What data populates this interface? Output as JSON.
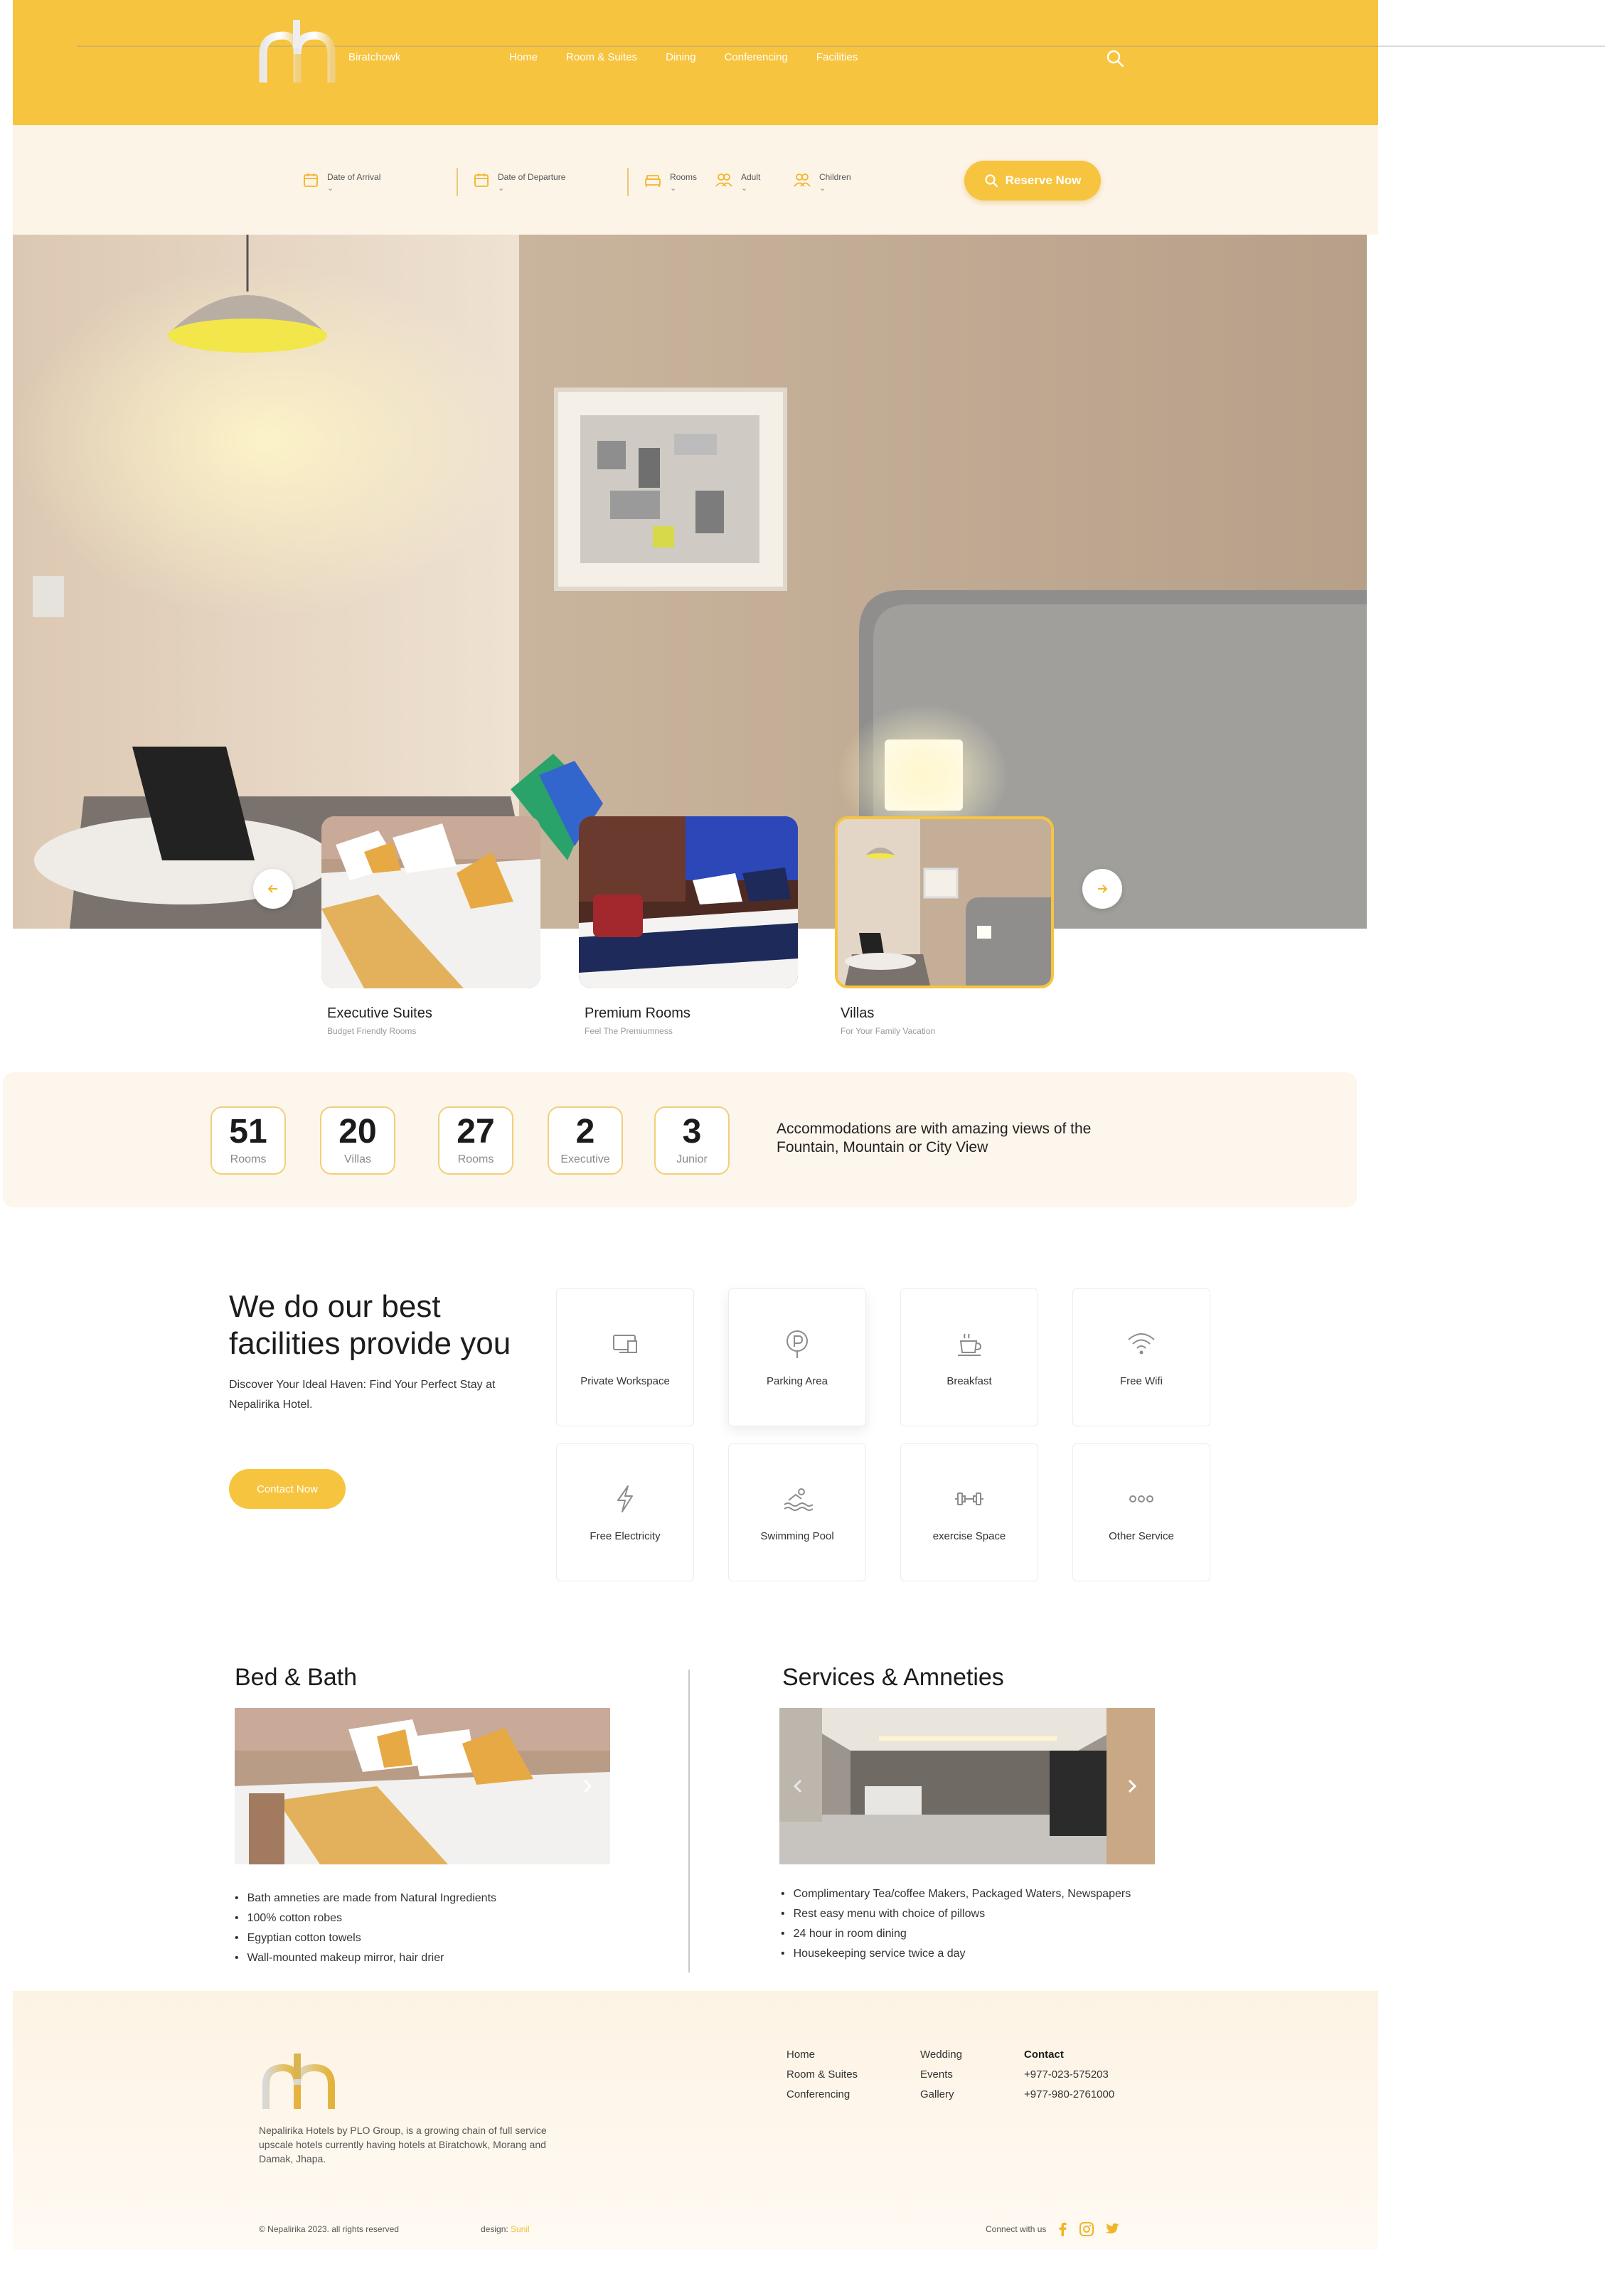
{
  "colors": {
    "accent": "#f7c43f",
    "accent_light": "#fdf4e8",
    "text": "#1f1f1f"
  },
  "header": {
    "brand": "Biratchowk",
    "nav": [
      "Home",
      "Room & Suites",
      "Dining",
      "Conferencing",
      "Facilities"
    ],
    "search_icon": "search-icon"
  },
  "booking": {
    "arrival": "Date of Arrival",
    "departure": "Date of Departure",
    "rooms": "Rooms",
    "adult": "Adult",
    "children": "Children",
    "reserve_label": "Reserve Now"
  },
  "rooms": [
    {
      "title": "Executive Suites",
      "subtitle": "Budget Friendly Rooms"
    },
    {
      "title": "Premium Rooms",
      "subtitle": "Feel The Premiumness"
    },
    {
      "title": "Villas",
      "subtitle": "For Your Family Vacation"
    }
  ],
  "stats": {
    "items": [
      {
        "value": "51",
        "label": "Rooms"
      },
      {
        "value": "20",
        "label": "Villas"
      },
      {
        "value": "27",
        "label": "Rooms"
      },
      {
        "value": "2",
        "label": "Executive"
      },
      {
        "value": "3",
        "label": "Junior"
      }
    ],
    "text": "Accommodations are with amazing views of the Fountain, Mountain or City View"
  },
  "facilities": {
    "heading": "We do our best facilities provide you",
    "description": "Discover Your Ideal Haven: Find Your Perfect Stay at Nepalirika Hotel.",
    "contact_label": "Contact Now",
    "items": [
      {
        "label": "Private Workspace",
        "icon": "workspace-icon"
      },
      {
        "label": "Parking Area",
        "icon": "parking-icon"
      },
      {
        "label": "Breakfast",
        "icon": "coffee-icon"
      },
      {
        "label": "Free Wifi",
        "icon": "wifi-icon"
      },
      {
        "label": "Free Electricity",
        "icon": "lightning-icon"
      },
      {
        "label": "Swimming Pool",
        "icon": "swimming-icon"
      },
      {
        "label": "exercise Space",
        "icon": "dumbbell-icon"
      },
      {
        "label": "Other Service",
        "icon": "more-icon"
      }
    ]
  },
  "bed_bath": {
    "title": "Bed & Bath",
    "bullets": [
      "Bath amneties are made from Natural Ingredients",
      "100% cotton robes",
      "Egyptian cotton towels",
      "Wall-mounted makeup mirror, hair drier"
    ]
  },
  "services": {
    "title": "Services & Amneties",
    "bullets": [
      "Complimentary Tea/coffee Makers, Packaged Waters, Newspapers",
      "Rest easy menu with choice of pillows",
      "24 hour in room dining",
      "Housekeeping service twice a day"
    ]
  },
  "footer": {
    "about": "Nepalirika Hotels by PLO Group, is a growing chain of full service upscale hotels currently having hotels at Biratchowk, Morang and Damak, Jhapa.",
    "col1": [
      "Home",
      "Room & Suites",
      "Conferencing"
    ],
    "col2": [
      "Wedding",
      "Events",
      "Gallery"
    ],
    "contact_header": "Contact",
    "phones": [
      "+977-023-575203",
      "+977-980-2761000"
    ],
    "copyright": "© Nepalirika  2023. all rights reserved",
    "design_label": "design:",
    "design_name": "Sunil",
    "connect": "Connect with us"
  }
}
